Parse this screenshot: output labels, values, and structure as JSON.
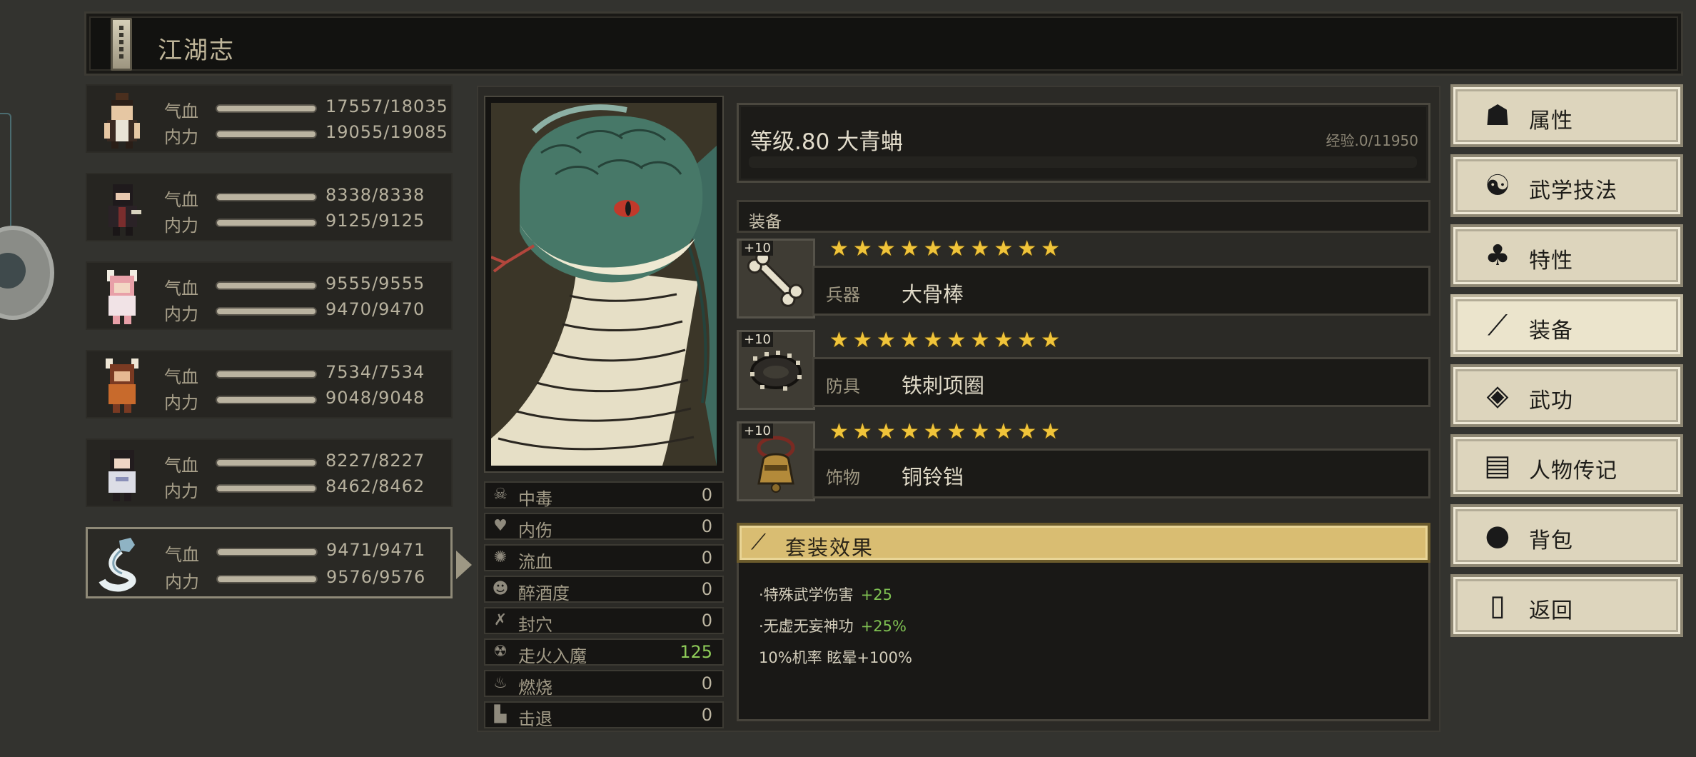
{
  "window": {
    "title": "江湖志"
  },
  "party": [
    {
      "hp_label": "气血",
      "hp": "17557/18035",
      "mp_label": "内力",
      "mp": "19055/19085",
      "selected": false
    },
    {
      "hp_label": "气血",
      "hp": "8338/8338",
      "mp_label": "内力",
      "mp": "9125/9125",
      "selected": false
    },
    {
      "hp_label": "气血",
      "hp": "9555/9555",
      "mp_label": "内力",
      "mp": "9470/9470",
      "selected": false
    },
    {
      "hp_label": "气血",
      "hp": "7534/7534",
      "mp_label": "内力",
      "mp": "9048/9048",
      "selected": false
    },
    {
      "hp_label": "气血",
      "hp": "8227/8227",
      "mp_label": "内力",
      "mp": "8462/8462",
      "selected": false
    },
    {
      "hp_label": "气血",
      "hp": "9471/9471",
      "mp_label": "内力",
      "mp": "9576/9576",
      "selected": true
    }
  ],
  "character": {
    "level_text": "等级.80 大青蚺",
    "exp_text": "经验.0/11950"
  },
  "status_effects": [
    {
      "icon": "skull-icon",
      "name": "中毒",
      "value": "0"
    },
    {
      "icon": "broken-heart-icon",
      "name": "内伤",
      "value": "0"
    },
    {
      "icon": "blood-icon",
      "name": "流血",
      "value": "0"
    },
    {
      "icon": "drunk-icon",
      "name": "醉酒度",
      "value": "0"
    },
    {
      "icon": "seal-icon",
      "name": "封穴",
      "value": "0"
    },
    {
      "icon": "demon-icon",
      "name": "走火入魔",
      "value": "125",
      "highlight": "#8ecb58"
    },
    {
      "icon": "fire-icon",
      "name": "燃烧",
      "value": "0"
    },
    {
      "icon": "knockback-icon",
      "name": "击退",
      "value": "0"
    }
  ],
  "equipment": {
    "header": "装备",
    "slots": [
      {
        "plus": "+10",
        "stars": 10,
        "type": "兵器",
        "name": "大骨棒",
        "icon": "bone-club-icon"
      },
      {
        "plus": "+10",
        "stars": 10,
        "type": "防具",
        "name": "铁刺项圈",
        "icon": "spiked-collar-icon"
      },
      {
        "plus": "+10",
        "stars": 10,
        "type": "饰物",
        "name": "铜铃铛",
        "icon": "bronze-bell-icon"
      }
    ]
  },
  "set_effect": {
    "title": "套装效果",
    "lines": [
      {
        "text": "·特殊武学伤害",
        "bonus": "+25"
      },
      {
        "text": "·无虚无妄神功",
        "bonus": "+25%"
      },
      {
        "text": "10%机率 眩晕+100%",
        "bonus": ""
      }
    ]
  },
  "menu": [
    {
      "label": "属性",
      "icon": "attributes-icon",
      "active": false
    },
    {
      "label": "武学技法",
      "icon": "martial-arts-icon",
      "active": false
    },
    {
      "label": "特性",
      "icon": "traits-icon",
      "active": false
    },
    {
      "label": "装备",
      "icon": "sword-icon",
      "active": true
    },
    {
      "label": "武功",
      "icon": "book-icon",
      "active": false
    },
    {
      "label": "人物传记",
      "icon": "scroll-icon",
      "active": false
    },
    {
      "label": "背包",
      "icon": "bag-icon",
      "active": false
    },
    {
      "label": "返回",
      "icon": "door-icon",
      "active": false
    }
  ],
  "colors": {
    "star": "#f0c43a",
    "set_header": "#d9bd72",
    "positive": "#7fc052"
  }
}
